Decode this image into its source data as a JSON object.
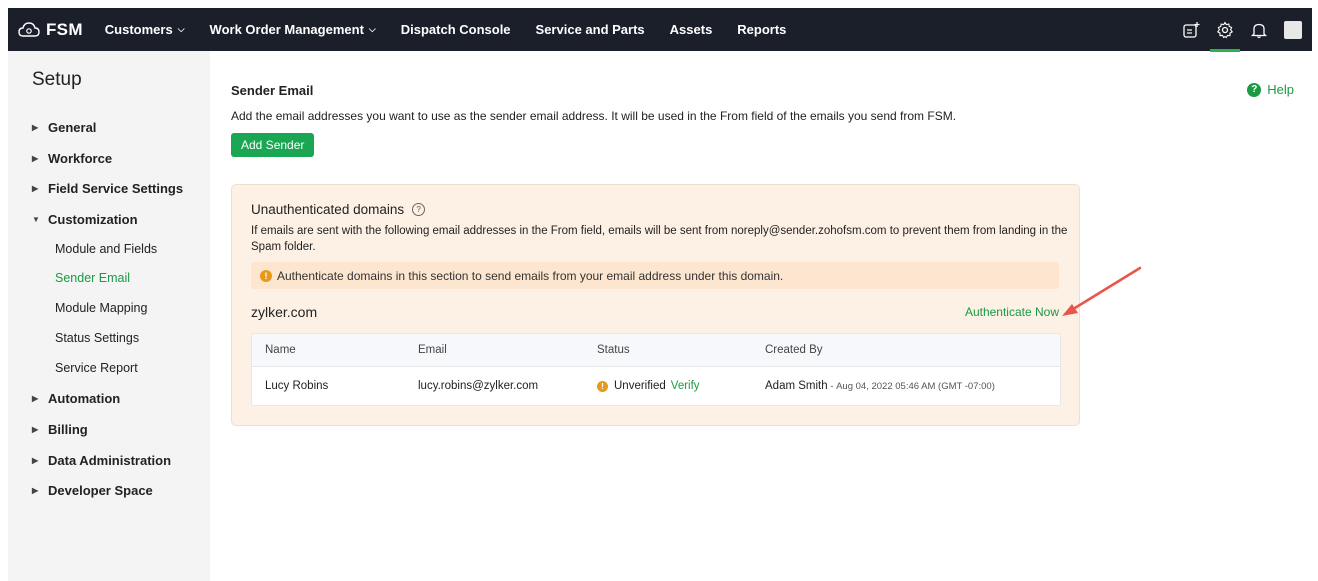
{
  "topbar": {
    "brand": "FSM",
    "nav": [
      {
        "label": "Customers",
        "has_dropdown": true
      },
      {
        "label": "Work Order Management",
        "has_dropdown": true
      },
      {
        "label": "Dispatch Console",
        "has_dropdown": false
      },
      {
        "label": "Service and Parts",
        "has_dropdown": false
      },
      {
        "label": "Assets",
        "has_dropdown": false
      },
      {
        "label": "Reports",
        "has_dropdown": false
      }
    ],
    "icons": [
      "add-note-icon",
      "gear-icon",
      "bell-icon",
      "avatar"
    ]
  },
  "sidebar": {
    "title": "Setup",
    "items": [
      {
        "label": "General",
        "expanded": false
      },
      {
        "label": "Workforce",
        "expanded": false
      },
      {
        "label": "Field Service Settings",
        "expanded": false
      },
      {
        "label": "Customization",
        "expanded": true
      },
      {
        "label": "Automation",
        "expanded": false
      },
      {
        "label": "Billing",
        "expanded": false
      },
      {
        "label": "Data Administration",
        "expanded": false
      },
      {
        "label": "Developer Space",
        "expanded": false
      }
    ],
    "customization_children": [
      {
        "label": "Module and Fields",
        "active": false
      },
      {
        "label": "Sender Email",
        "active": true
      },
      {
        "label": "Module Mapping",
        "active": false
      },
      {
        "label": "Status Settings",
        "active": false
      },
      {
        "label": "Service Report",
        "active": false
      }
    ]
  },
  "main": {
    "title": "Sender Email",
    "description": "Add the email addresses you want to use as the sender email address. It will be used in the From field of the emails you send from FSM.",
    "add_button": "Add Sender",
    "help_label": "Help",
    "panel": {
      "title": "Unauthenticated domains",
      "description": "If emails are sent with the following email addresses in the From field, emails will be sent from noreply@sender.zohofsm.com to prevent them from landing in the Spam folder.",
      "notice": "Authenticate domains in this section to send emails from your email address under this domain.",
      "domain": "zylker.com",
      "authenticate_label": "Authenticate Now",
      "table": {
        "headers": [
          "Name",
          "Email",
          "Status",
          "Created By"
        ],
        "rows": [
          {
            "name": "Lucy Robins",
            "email": "lucy.robins@zylker.com",
            "status": "Unverified",
            "verify_label": "Verify",
            "created_by": "Adam Smith",
            "created_sep": " - ",
            "created_date": "Aug 04, 2022 05:46 AM (GMT -07:00)"
          }
        ]
      }
    }
  },
  "colors": {
    "topbar_bg": "#1b1f2a",
    "accent_green": "#1a9a43",
    "button_green": "#1aa652",
    "panel_bg": "#fdf1e6",
    "notice_bg": "#fde6cf",
    "warning_orange": "#e89a16",
    "annotation_arrow": "#e8554a"
  }
}
